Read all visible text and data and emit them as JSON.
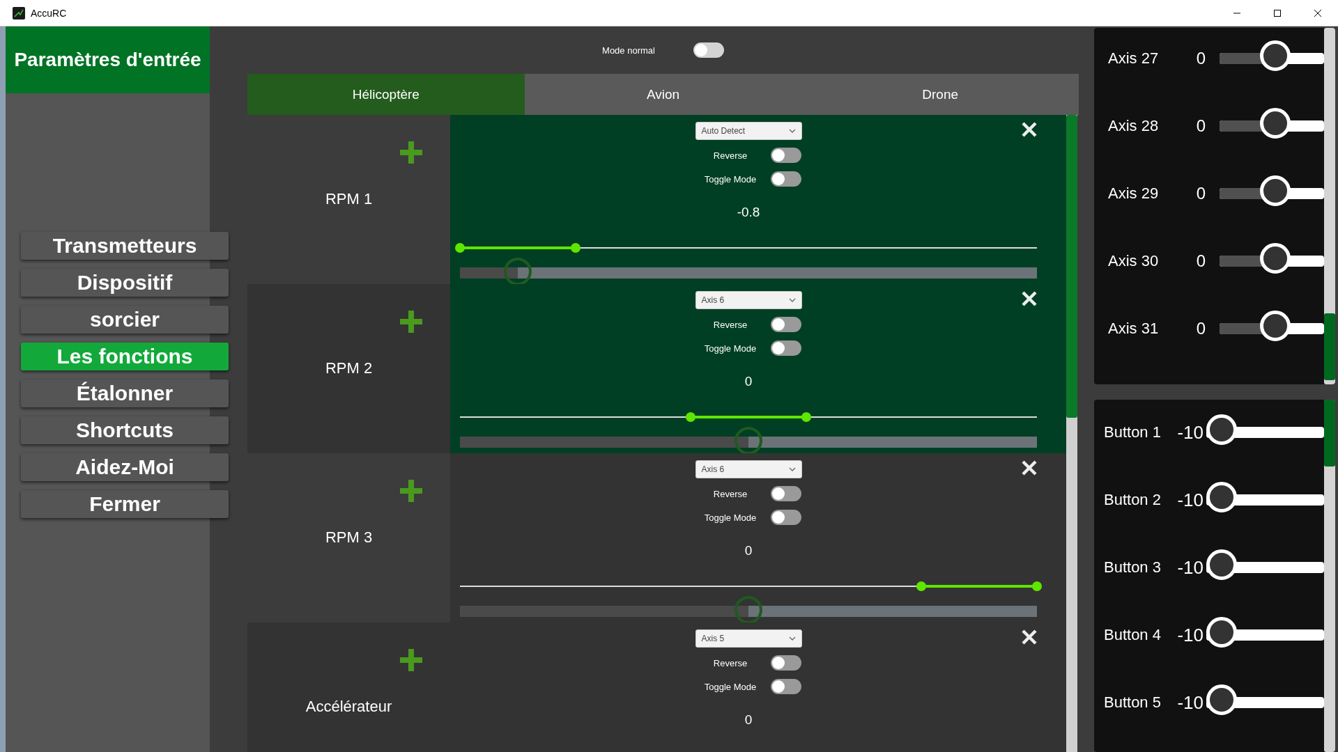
{
  "window": {
    "title": "AccuRC"
  },
  "sidebar": {
    "title": "Paramètres d'entrée",
    "items": [
      {
        "label": "Transmetteurs",
        "selected": false
      },
      {
        "label": "Dispositif",
        "selected": false
      },
      {
        "label": "sorcier",
        "selected": false
      },
      {
        "label": "Les fonctions",
        "selected": true
      },
      {
        "label": "Étalonner",
        "selected": false
      },
      {
        "label": "Shortcuts",
        "selected": false
      },
      {
        "label": "Aidez-Moi",
        "selected": false
      },
      {
        "label": "Fermer",
        "selected": false
      }
    ]
  },
  "mode": {
    "label": "Mode normal",
    "on": false
  },
  "tabs": [
    {
      "label": "Hélicoptère",
      "selected": true
    },
    {
      "label": "Avion",
      "selected": false
    },
    {
      "label": "Drone",
      "selected": false
    }
  ],
  "cards": [
    {
      "name": "RPM 1",
      "input": "Auto Detect",
      "selected": true,
      "reverse": {
        "label": "Reverse",
        "on": false
      },
      "toggle_mode": {
        "label": "Toggle Mode",
        "on": false
      },
      "value": "-0.8",
      "range_start": {
        "level": 0
      },
      "range_end": {
        "level": 0.2
      },
      "output": {
        "level": 0.1
      }
    },
    {
      "name": "RPM 2",
      "input": "Axis 6",
      "selected": true,
      "reverse": {
        "label": "Reverse",
        "on": false
      },
      "toggle_mode": {
        "label": "Toggle Mode",
        "on": false
      },
      "value": "0",
      "range_start": {
        "level": 0.4
      },
      "range_end": {
        "level": 0.6
      },
      "output": {
        "level": 0.5
      }
    },
    {
      "name": "RPM 3",
      "input": "Axis 6",
      "selected": false,
      "reverse": {
        "label": "Reverse",
        "on": false
      },
      "toggle_mode": {
        "label": "Toggle Mode",
        "on": false
      },
      "value": "0",
      "range_start": {
        "level": 0.8
      },
      "range_end": {
        "level": 1
      },
      "output": {
        "level": 0.5
      }
    },
    {
      "name": "Accélérateur",
      "input": "Axis 5",
      "selected": false,
      "reverse": {
        "label": "Reverse",
        "on": false
      },
      "toggle_mode": {
        "label": "Toggle Mode",
        "on": false
      },
      "value": "0"
    }
  ],
  "axes": [
    {
      "label": "Axis 27",
      "value": "0",
      "level": 0.5
    },
    {
      "label": "Axis 28",
      "value": "0",
      "level": 0.5
    },
    {
      "label": "Axis 29",
      "value": "0",
      "level": 0.5
    },
    {
      "label": "Axis 30",
      "value": "0",
      "level": 0.5
    },
    {
      "label": "Axis 31",
      "value": "0",
      "level": 0.5
    }
  ],
  "buttons": [
    {
      "label": "Button 1",
      "value": "-10",
      "level": 0
    },
    {
      "label": "Button 2",
      "value": "-10",
      "level": 0
    },
    {
      "label": "Button 3",
      "value": "-10",
      "level": 0
    },
    {
      "label": "Button 4",
      "value": "-10",
      "level": 0
    },
    {
      "label": "Button 5",
      "value": "-10",
      "level": 0
    }
  ]
}
